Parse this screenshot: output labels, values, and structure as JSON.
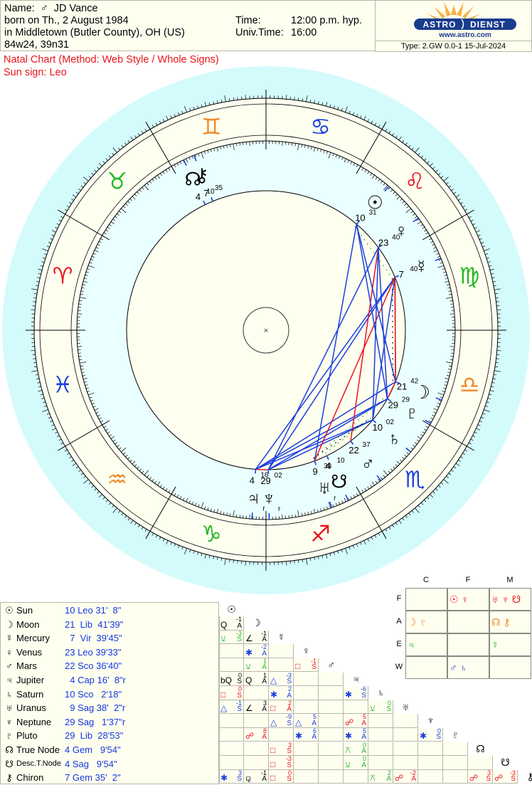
{
  "header": {
    "name_label": "Name:",
    "gender_symbol": "♂",
    "name": "JD Vance",
    "birth_line": "born on Th., 2 August 1984",
    "place_line": "in Middletown (Butler County), OH (US)",
    "coords": "84w24, 39n31",
    "time_label": "Time:",
    "time_value": "12:00 p.m. hyp.",
    "ut_label": "Univ.Time:",
    "ut_value": "16:00"
  },
  "logo": {
    "left": "ASTRO",
    "right": "DIENST",
    "url": "www.astro.com"
  },
  "type_line": "Type: 2.GW   0.0-1  15-Jul-2024",
  "subtitle": {
    "line1": "Natal Chart  (Method: Web Style / Whole Signs)",
    "line2": "Sun sign: Leo"
  },
  "colors": {
    "fire": "#e8151b",
    "earth": "#22b822",
    "air": "#f08a28",
    "water": "#1a3fe0",
    "aspect_hard": "#e8151b",
    "aspect_soft": "#1a3fe0",
    "aspect_minor": "#22b822",
    "wheel_outer": "#d4fbfc",
    "ring_fill": "#fffff0",
    "inner_fill": "#eaffff"
  },
  "planet_table": [
    {
      "glyph": "☉",
      "name": "Sun",
      "pos": "10 Leo 31'  8\""
    },
    {
      "glyph": "☽",
      "name": "Moon",
      "pos": "21  Lib  41'39\""
    },
    {
      "glyph": "☿",
      "name": "Mercury",
      "pos": "  7  Vir  39'45\""
    },
    {
      "glyph": "♀",
      "name": "Venus",
      "pos": "23 Leo 39'33\""
    },
    {
      "glyph": "♂",
      "name": "Mars",
      "pos": "22 Sco 36'40\""
    },
    {
      "glyph": "♃",
      "name": "Jupiter",
      "pos": "  4 Cap 16'  8\"r"
    },
    {
      "glyph": "♄",
      "name": "Saturn",
      "pos": "10 Sco   2'18\""
    },
    {
      "glyph": "♅",
      "name": "Uranus",
      "pos": "  9 Sag 38'  2\"r"
    },
    {
      "glyph": "♆",
      "name": "Neptune",
      "pos": "29 Sag   1'37\"r"
    },
    {
      "glyph": "♇",
      "name": "Pluto",
      "pos": "29  Lib  28'53\""
    },
    {
      "glyph": "☊",
      "name": "True Node",
      "pos": "4 Gem   9'54\""
    },
    {
      "glyph": "☋",
      "name": "Desc.T.Node",
      "pos": "4 Sag   9'54\"",
      "small": true
    },
    {
      "glyph": "⚷",
      "name": "Chiron",
      "pos": "7 Gem 35'  2\""
    }
  ],
  "aspect_grid": {
    "headers": [
      "☉",
      "☽",
      "☿",
      "♀",
      "♂",
      "♃",
      "♄",
      "♅",
      "♆",
      "♇",
      "☊",
      "☋",
      "⚷"
    ],
    "cells": [
      {
        "r": 1,
        "c": 0,
        "sym": "Q",
        "num": "-1",
        "orb": "A",
        "color": "#000000"
      },
      {
        "r": 2,
        "c": 0,
        "sym": "⚺",
        "num": "-3",
        "orb": "S",
        "color": "#22b822"
      },
      {
        "r": 2,
        "c": 1,
        "sym": "∠",
        "num": "-1",
        "orb": "A",
        "color": "#000000"
      },
      {
        "r": 3,
        "c": 1,
        "sym": "✱",
        "num": "-2",
        "orb": "A",
        "color": "#1a3fe0"
      },
      {
        "r": 4,
        "c": 1,
        "sym": "⚺",
        "num": "1",
        "orb": "A",
        "color": "#22b822"
      },
      {
        "r": 4,
        "c": 3,
        "sym": "□",
        "num": "-1",
        "orb": "S",
        "color": "#e8151b"
      },
      {
        "r": 5,
        "c": 0,
        "sym": "bQ",
        "num": "0",
        "orb": "S",
        "color": "#000000"
      },
      {
        "r": 5,
        "c": 1,
        "sym": "Q",
        "num": "1",
        "orb": "A",
        "color": "#000000"
      },
      {
        "r": 5,
        "c": 2,
        "sym": "△",
        "num": "-3",
        "orb": "S",
        "color": "#1a3fe0"
      },
      {
        "r": 6,
        "c": 0,
        "sym": "□",
        "num": "0",
        "orb": "S",
        "color": "#e8151b"
      },
      {
        "r": 6,
        "c": 2,
        "sym": "✱",
        "num": "2",
        "orb": "A",
        "color": "#1a3fe0"
      },
      {
        "r": 6,
        "c": 5,
        "sym": "✱",
        "num": "-6",
        "orb": "S",
        "color": "#1a3fe0"
      },
      {
        "r": 7,
        "c": 0,
        "sym": "△",
        "num": "-1",
        "orb": "S",
        "color": "#1a3fe0"
      },
      {
        "r": 7,
        "c": 1,
        "sym": "∠",
        "num": "3",
        "orb": "A",
        "color": "#000000"
      },
      {
        "r": 7,
        "c": 2,
        "sym": "□",
        "num": "2",
        "orb": "A",
        "color": "#e8151b"
      },
      {
        "r": 7,
        "c": 6,
        "sym": "⚺",
        "num": "0",
        "orb": "S",
        "color": "#22b822"
      },
      {
        "r": 8,
        "c": 2,
        "sym": "△",
        "num": "-9",
        "orb": "S",
        "color": "#1a3fe0"
      },
      {
        "r": 8,
        "c": 3,
        "sym": "△",
        "num": "5",
        "orb": "A",
        "color": "#1a3fe0"
      },
      {
        "r": 8,
        "c": 5,
        "sym": "☍",
        "num": "5",
        "orb": "A",
        "color": "#e8151b"
      },
      {
        "r": 9,
        "c": 1,
        "sym": "☍",
        "num": "8",
        "orb": "A",
        "color": "#e8151b"
      },
      {
        "r": 9,
        "c": 3,
        "sym": "✱",
        "num": "6",
        "orb": "A",
        "color": "#1a3fe0"
      },
      {
        "r": 9,
        "c": 5,
        "sym": "✱",
        "num": "5",
        "orb": "A",
        "color": "#1a3fe0"
      },
      {
        "r": 9,
        "c": 8,
        "sym": "✱",
        "num": "0",
        "orb": "S",
        "color": "#1a3fe0"
      },
      {
        "r": 10,
        "c": 2,
        "sym": "□",
        "num": "3",
        "orb": "S",
        "color": "#e8151b"
      },
      {
        "r": 10,
        "c": 5,
        "sym": "⚻",
        "num": "0",
        "orb": "A",
        "color": "#22b822"
      },
      {
        "r": 11,
        "c": 2,
        "sym": "□",
        "num": "-3",
        "orb": "S",
        "color": "#e8151b"
      },
      {
        "r": 11,
        "c": 5,
        "sym": "⚺",
        "num": "0",
        "orb": "A",
        "color": "#22b822"
      },
      {
        "r": 12,
        "c": 0,
        "sym": "✱",
        "num": "3",
        "orb": "S",
        "color": "#1a3fe0"
      },
      {
        "r": 12,
        "c": 1,
        "sym": "⚼",
        "num": "-1",
        "orb": "A",
        "color": "#000000"
      },
      {
        "r": 12,
        "c": 2,
        "sym": "□",
        "num": "0",
        "orb": "S",
        "color": "#e8151b"
      },
      {
        "r": 12,
        "c": 6,
        "sym": "⚻",
        "num": "2",
        "orb": "A",
        "color": "#22b822"
      },
      {
        "r": 12,
        "c": 7,
        "sym": "☍",
        "num": "-2",
        "orb": "A",
        "color": "#e8151b"
      },
      {
        "r": 12,
        "c": 10,
        "sym": "☍",
        "num": "3",
        "orb": "S",
        "color": "#e8151b"
      },
      {
        "r": 12,
        "c": 11,
        "sym": "☍",
        "num": "-3",
        "orb": "S",
        "color": "#e8151b"
      }
    ]
  },
  "elements_table": {
    "columns": [
      "C",
      "F",
      "M"
    ],
    "rows": [
      "F",
      "A",
      "E",
      "W"
    ],
    "cells": [
      [
        "",
        "☉♀",
        "♅♆☋"
      ],
      [
        "☽♇",
        "",
        "☊⚷"
      ],
      [
        "♃",
        "",
        "☿"
      ],
      [
        "",
        "♂♄",
        ""
      ]
    ],
    "row_colors": [
      "#e8151b",
      "#f08a28",
      "#22b822",
      "#1a3fe0"
    ]
  },
  "chart_data": {
    "type": "natal-wheel",
    "title": "Natal Chart (Method: Web Style / Whole Signs)",
    "ascendant_sign": "Aries",
    "house_system": "Whole Signs",
    "signs": [
      {
        "name": "Aries",
        "glyph": "♈",
        "element": "fire"
      },
      {
        "name": "Taurus",
        "glyph": "♉",
        "element": "earth"
      },
      {
        "name": "Gemini",
        "glyph": "♊",
        "element": "air"
      },
      {
        "name": "Cancer",
        "glyph": "♋",
        "element": "water"
      },
      {
        "name": "Leo",
        "glyph": "♌",
        "element": "fire"
      },
      {
        "name": "Virgo",
        "glyph": "♍",
        "element": "earth"
      },
      {
        "name": "Libra",
        "glyph": "♎",
        "element": "air"
      },
      {
        "name": "Scorpio",
        "glyph": "♏",
        "element": "water"
      },
      {
        "name": "Sagittarius",
        "glyph": "♐",
        "element": "fire"
      },
      {
        "name": "Capricorn",
        "glyph": "♑",
        "element": "earth"
      },
      {
        "name": "Aquarius",
        "glyph": "♒",
        "element": "air"
      },
      {
        "name": "Pisces",
        "glyph": "♓",
        "element": "water"
      }
    ],
    "planets": [
      {
        "name": "Sun",
        "glyph": "☉",
        "lon": 130.52,
        "deg": "10",
        "min": "31",
        "retro": false
      },
      {
        "name": "Moon",
        "glyph": "☽",
        "lon": 201.69,
        "deg": "21",
        "min": "42",
        "retro": false
      },
      {
        "name": "Mercury",
        "glyph": "☿",
        "lon": 157.66,
        "deg": "7",
        "min": "40",
        "retro": false
      },
      {
        "name": "Venus",
        "glyph": "♀",
        "lon": 143.66,
        "deg": "23",
        "min": "40",
        "retro": false
      },
      {
        "name": "Mars",
        "glyph": "♂",
        "lon": 232.61,
        "deg": "22",
        "min": "37",
        "retro": false
      },
      {
        "name": "Jupiter",
        "glyph": "♃",
        "lon": 274.27,
        "deg": "4",
        "min": "16",
        "retro": true
      },
      {
        "name": "Saturn",
        "glyph": "♄",
        "lon": 220.04,
        "deg": "10",
        "min": "02",
        "retro": false
      },
      {
        "name": "Uranus",
        "glyph": "♅",
        "lon": 249.63,
        "deg": "9",
        "min": "38",
        "retro": true
      },
      {
        "name": "Neptune",
        "glyph": "♆",
        "lon": 269.03,
        "deg": "29",
        "min": "02",
        "retro": true
      },
      {
        "name": "Pluto",
        "glyph": "♇",
        "lon": 209.48,
        "deg": "29",
        "min": "29",
        "retro": false
      },
      {
        "name": "True Node",
        "glyph": "☊",
        "lon": 64.17,
        "deg": "4",
        "min": "10",
        "retro": false
      },
      {
        "name": "Desc. Node",
        "glyph": "☋",
        "lon": 244.17,
        "deg": "4",
        "min": "10",
        "retro": false
      },
      {
        "name": "Chiron",
        "glyph": "⚷",
        "lon": 67.58,
        "deg": "7",
        "min": "35",
        "retro": false
      }
    ],
    "aspect_lines": [
      {
        "a": "Jupiter",
        "b": "Neptune",
        "kind": "hard"
      },
      {
        "a": "Jupiter",
        "b": "Saturn",
        "kind": "soft"
      },
      {
        "a": "Jupiter",
        "b": "Pluto",
        "kind": "soft"
      },
      {
        "a": "Jupiter",
        "b": "Mercury",
        "kind": "soft"
      },
      {
        "a": "Jupiter",
        "b": "Moon",
        "kind": "soft"
      },
      {
        "a": "Neptune",
        "b": "Saturn",
        "kind": "soft"
      },
      {
        "a": "Neptune",
        "b": "Pluto",
        "kind": "soft"
      },
      {
        "a": "Neptune",
        "b": "Mercury",
        "kind": "soft"
      },
      {
        "a": "Neptune",
        "b": "Venus",
        "kind": "soft"
      },
      {
        "a": "Uranus",
        "b": "Sun",
        "kind": "soft"
      },
      {
        "a": "Uranus",
        "b": "Mercury",
        "kind": "hard"
      },
      {
        "a": "Mars",
        "b": "Venus",
        "kind": "hard"
      },
      {
        "a": "Saturn",
        "b": "Mercury",
        "kind": "soft"
      },
      {
        "a": "Saturn",
        "b": "Venus",
        "kind": "soft"
      },
      {
        "a": "Pluto",
        "b": "Moon",
        "kind": "hard"
      },
      {
        "a": "Pluto",
        "b": "Sun",
        "kind": "soft"
      },
      {
        "a": "Pluto",
        "b": "Venus",
        "kind": "soft"
      },
      {
        "a": "Moon",
        "b": "Mercury",
        "kind": "soft"
      },
      {
        "a": "Mercury",
        "b": "Moon",
        "kind": "hard"
      },
      {
        "a": "Moon",
        "b": "Sun",
        "kind": "soft"
      }
    ],
    "minor_dotted": [
      {
        "a": "Uranus",
        "b": "Pluto",
        "kind": "minor"
      },
      {
        "a": "Desc. Node",
        "b": "Saturn",
        "kind": "minor"
      },
      {
        "a": "Moon",
        "b": "Mercury",
        "kind": "dot"
      },
      {
        "a": "Uranus",
        "b": "Saturn",
        "kind": "dot"
      },
      {
        "a": "Sun",
        "b": "Mercury",
        "kind": "minor"
      }
    ],
    "center_mark": "×"
  }
}
